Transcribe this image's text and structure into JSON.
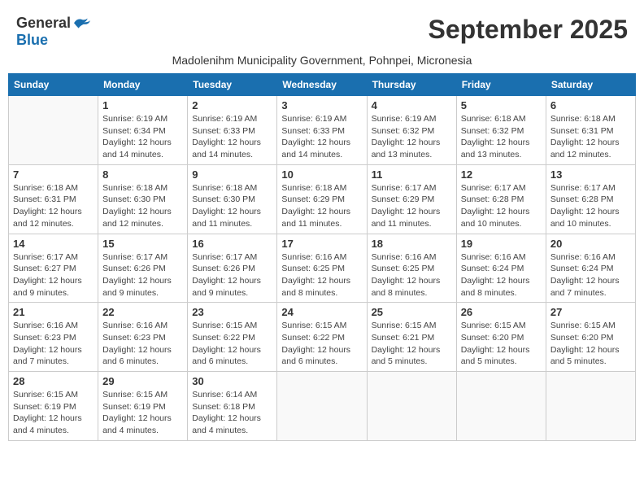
{
  "header": {
    "logo_general": "General",
    "logo_blue": "Blue",
    "month_title": "September 2025",
    "subtitle": "Madolenihm Municipality Government, Pohnpei, Micronesia"
  },
  "weekdays": [
    "Sunday",
    "Monday",
    "Tuesday",
    "Wednesday",
    "Thursday",
    "Friday",
    "Saturday"
  ],
  "weeks": [
    [
      {
        "day": "",
        "info": ""
      },
      {
        "day": "1",
        "info": "Sunrise: 6:19 AM\nSunset: 6:34 PM\nDaylight: 12 hours\nand 14 minutes."
      },
      {
        "day": "2",
        "info": "Sunrise: 6:19 AM\nSunset: 6:33 PM\nDaylight: 12 hours\nand 14 minutes."
      },
      {
        "day": "3",
        "info": "Sunrise: 6:19 AM\nSunset: 6:33 PM\nDaylight: 12 hours\nand 14 minutes."
      },
      {
        "day": "4",
        "info": "Sunrise: 6:19 AM\nSunset: 6:32 PM\nDaylight: 12 hours\nand 13 minutes."
      },
      {
        "day": "5",
        "info": "Sunrise: 6:18 AM\nSunset: 6:32 PM\nDaylight: 12 hours\nand 13 minutes."
      },
      {
        "day": "6",
        "info": "Sunrise: 6:18 AM\nSunset: 6:31 PM\nDaylight: 12 hours\nand 12 minutes."
      }
    ],
    [
      {
        "day": "7",
        "info": "Sunrise: 6:18 AM\nSunset: 6:31 PM\nDaylight: 12 hours\nand 12 minutes."
      },
      {
        "day": "8",
        "info": "Sunrise: 6:18 AM\nSunset: 6:30 PM\nDaylight: 12 hours\nand 12 minutes."
      },
      {
        "day": "9",
        "info": "Sunrise: 6:18 AM\nSunset: 6:30 PM\nDaylight: 12 hours\nand 11 minutes."
      },
      {
        "day": "10",
        "info": "Sunrise: 6:18 AM\nSunset: 6:29 PM\nDaylight: 12 hours\nand 11 minutes."
      },
      {
        "day": "11",
        "info": "Sunrise: 6:17 AM\nSunset: 6:29 PM\nDaylight: 12 hours\nand 11 minutes."
      },
      {
        "day": "12",
        "info": "Sunrise: 6:17 AM\nSunset: 6:28 PM\nDaylight: 12 hours\nand 10 minutes."
      },
      {
        "day": "13",
        "info": "Sunrise: 6:17 AM\nSunset: 6:28 PM\nDaylight: 12 hours\nand 10 minutes."
      }
    ],
    [
      {
        "day": "14",
        "info": "Sunrise: 6:17 AM\nSunset: 6:27 PM\nDaylight: 12 hours\nand 9 minutes."
      },
      {
        "day": "15",
        "info": "Sunrise: 6:17 AM\nSunset: 6:26 PM\nDaylight: 12 hours\nand 9 minutes."
      },
      {
        "day": "16",
        "info": "Sunrise: 6:17 AM\nSunset: 6:26 PM\nDaylight: 12 hours\nand 9 minutes."
      },
      {
        "day": "17",
        "info": "Sunrise: 6:16 AM\nSunset: 6:25 PM\nDaylight: 12 hours\nand 8 minutes."
      },
      {
        "day": "18",
        "info": "Sunrise: 6:16 AM\nSunset: 6:25 PM\nDaylight: 12 hours\nand 8 minutes."
      },
      {
        "day": "19",
        "info": "Sunrise: 6:16 AM\nSunset: 6:24 PM\nDaylight: 12 hours\nand 8 minutes."
      },
      {
        "day": "20",
        "info": "Sunrise: 6:16 AM\nSunset: 6:24 PM\nDaylight: 12 hours\nand 7 minutes."
      }
    ],
    [
      {
        "day": "21",
        "info": "Sunrise: 6:16 AM\nSunset: 6:23 PM\nDaylight: 12 hours\nand 7 minutes."
      },
      {
        "day": "22",
        "info": "Sunrise: 6:16 AM\nSunset: 6:23 PM\nDaylight: 12 hours\nand 6 minutes."
      },
      {
        "day": "23",
        "info": "Sunrise: 6:15 AM\nSunset: 6:22 PM\nDaylight: 12 hours\nand 6 minutes."
      },
      {
        "day": "24",
        "info": "Sunrise: 6:15 AM\nSunset: 6:22 PM\nDaylight: 12 hours\nand 6 minutes."
      },
      {
        "day": "25",
        "info": "Sunrise: 6:15 AM\nSunset: 6:21 PM\nDaylight: 12 hours\nand 5 minutes."
      },
      {
        "day": "26",
        "info": "Sunrise: 6:15 AM\nSunset: 6:20 PM\nDaylight: 12 hours\nand 5 minutes."
      },
      {
        "day": "27",
        "info": "Sunrise: 6:15 AM\nSunset: 6:20 PM\nDaylight: 12 hours\nand 5 minutes."
      }
    ],
    [
      {
        "day": "28",
        "info": "Sunrise: 6:15 AM\nSunset: 6:19 PM\nDaylight: 12 hours\nand 4 minutes."
      },
      {
        "day": "29",
        "info": "Sunrise: 6:15 AM\nSunset: 6:19 PM\nDaylight: 12 hours\nand 4 minutes."
      },
      {
        "day": "30",
        "info": "Sunrise: 6:14 AM\nSunset: 6:18 PM\nDaylight: 12 hours\nand 4 minutes."
      },
      {
        "day": "",
        "info": ""
      },
      {
        "day": "",
        "info": ""
      },
      {
        "day": "",
        "info": ""
      },
      {
        "day": "",
        "info": ""
      }
    ]
  ]
}
